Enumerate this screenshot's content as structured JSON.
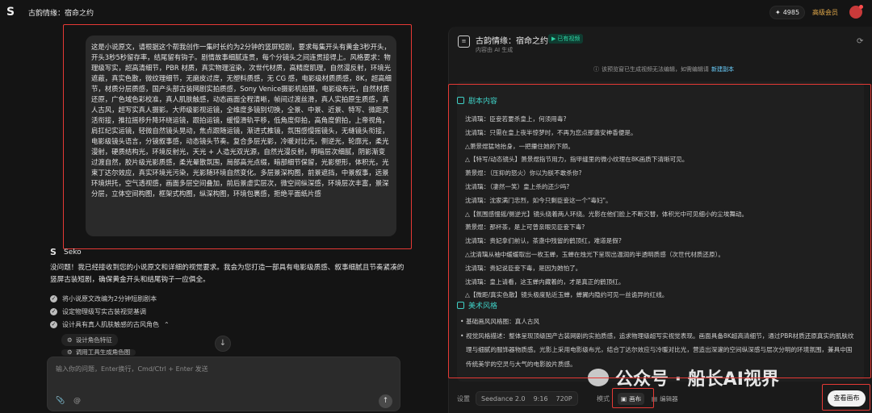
{
  "app": {
    "logo_glyph": "S",
    "title": "古韵情缘：宿命之约"
  },
  "account": {
    "credits": "4985",
    "credit_icon": "✦",
    "vip_label": "高级会员"
  },
  "prompt": {
    "text": "这是小说原文，请根据这个帮我创作一集时长约为2分钟的竖屏短剧，要求每集开头有黄金3秒开头，开头3秒5秒留存率，结尾留有钩子。剧情故事细腻连贯，每个分镜头之间连贯接得上。风格要求：物理级写实，超高清细节，PBR 材质，真实物理渲染，次世代材质，高精度肌理，自然漫反射，环境光遮蔽，真实色散，微纹理细节，无磨皮过度，无塑料质感，无 CG 感，电影级材质质感，8K，超高细节，材质分层质感，国产头部古装网剧实拍质感，Sony Venice摄影机拍摄，电影级布光，自然材质还原，广色域色彩校准，真人肌肤触感，动态画面全程清晰，帧间过渡丝滑，真人实拍原生质感，真人古风，超写实真人摄影。大师级影视运镜，全维度多镜别切换，全景、中景、近景、特写、微距灵活衔接，推拉摇移升降环绕运镜，跟拍运镜，缓慢滑轨平移，低角度仰拍，高角度俯拍，上帝视角，肩扛纪实运镜，轻微自然镜头晃动，焦点跟随运镜，渐进式推镜，氛围感慢摇镜头，无缝镜头衔接，电影级镜头语言，分镜叙事感，动态镜头节奏。复合多层光影，冷暖对比光，侧逆光，轮廓光，柔光漫射，硬质结构光，环境反射光，天光 + 人造光双光源，自然光漫反射，明暗层次细腻，阴影渐变过渡自然，胶片级光影质感，柔光晕散氛围，局部高光点缀，暗部细节保留，光影塑形，体积光，光束丁达尔效应，真实环境光污染，光影随环境自然变化。多层景深构图，前景遮挡，中景叙事，远景环境烘托，空气透视感，画面多层空间叠加，前后景虚实层次，微空间纵深感，环境层次丰富，景深分层，立体空间构图，框架式构图，纵深构图，环境包裹感，拒绝平面纸片感"
  },
  "assistant": {
    "name": "Seko",
    "reply": "没问题！我已经接收到您的小说原文和详细的视觉要求。我会为您打造一部具有电影级质感、叙事细腻且节奏紧凑的竖屏古装短剧，确保黄金开头和结尾钩子一应俱全。",
    "steps": [
      "将小说原文改编为2分钟短剧剧本",
      "设定物理级写实古装视觉基调",
      "设计具有真人肌肤触感的古风角色"
    ],
    "step3_chevron": "⌃",
    "substeps": [
      "设计角色特征",
      "调用工具生成角色图"
    ]
  },
  "composer": {
    "placeholder": "输入你的问题，Enter换行，Cmd/Ctrl + Enter 发送"
  },
  "panel": {
    "title": "古韵情缘：宿命之约",
    "badge": "已有视频",
    "subtitle": "内容由 AI 生成",
    "notice_text": "该预览窗已生成视频无法编辑，如需编辑请",
    "notice_link": "新建副本",
    "script_heading": "剧本内容",
    "script_lines": [
      "沈清璃：臣妾若要杀皇上，何须用毒?",
      "沈清璃：只需在皇上夜半惊梦时，不再为您点那盏安神香便是。",
      "△萧景煜猛地抬身，一把攥住她的下颌。",
      "△【特写/动态镜头】萧景煜指节用力，指甲缝里的微小纹理在8K画质下清晰可见。",
      "萧景煜：（压抑的怒火）你以为朕不敢杀你?",
      "沈清璃：（凄然一笑）皇上杀的还少吗?",
      "沈清璃：沈家满门忠烈，如今只剩臣妾这一个\"毒妇\"。",
      "△【氛围感慢摇/侧逆光】镜头绕着两人环绕。光影在他们脸上不断交替，体积光中可见细小的尘埃舞动。",
      "萧景煜：那杯茶，是上可曾亲眼见臣妾下毒?",
      "沈清璃：贵妃拿们前认，茶盏中残留的鹤顶红，难道是假?",
      "△沈清璃从袖中缓缓取出一枚玉蝉，玉蝉在烛光下呈现出温润的半透明质感（次世代材质还原）。",
      "沈清璃：贵妃说臣妾下毒，是因为她怕了。",
      "沈清璃：皇上请看，这玉蝉内藏着的，才是真正的鹤顶红。",
      "△【微距/真实色散】镜头极度贴近玉蝉，蝉翼内隐约可见一丝诡异的红线。"
    ],
    "style_heading": "美术风格",
    "style_bullets": [
      "基础画风风格图：真人古风",
      "视觉风格描述：整体呈现顶级国产古装网剧的实拍质感，追求物理级超写实视觉表现。画面具备8K超高清细节，通过PBR材质还原真实的肌肤纹理与细腻的服饰器物质感。光影上采用电影级布光，结合丁达尔效应与冷暖对比光，营造出深邃的空间纵深感与层次分明的环境氛围，兼具中国传统美学的空灵与大气的电影胶片质感。"
    ],
    "watermark": "公众号 · 船长AI视界"
  },
  "bottom_bar": {
    "settings_label": "设置",
    "model": "Seedance 2.0",
    "ratio": "9:16",
    "resolution": "720P",
    "mode_label": "模式",
    "mode_canvas": "画布",
    "mode_editor": "编辑器",
    "view_canvas": "查看画布"
  },
  "colors": {
    "accent_teal": "#3fd0c6",
    "badge_green": "#2ed3a3",
    "highlight_red": "#e53935",
    "vip_gold": "#e2a94a"
  }
}
